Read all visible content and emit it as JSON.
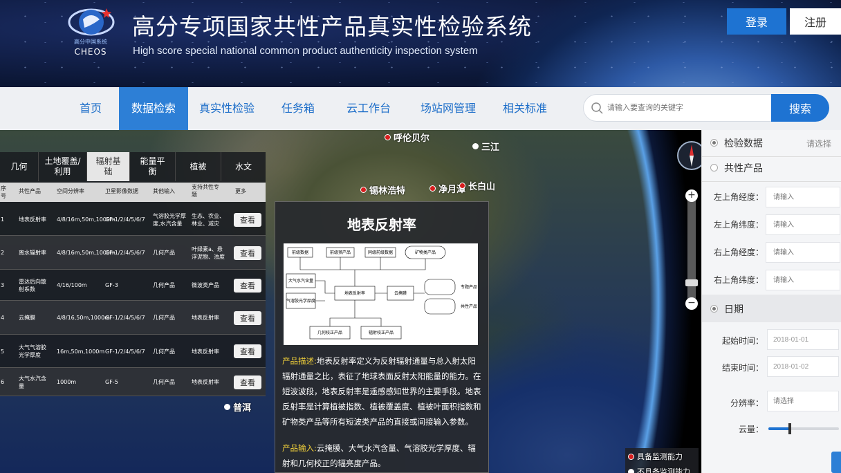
{
  "header": {
    "title_cn": "高分专项国家共性产品真实性检验系统",
    "title_en": "High score special national common product authenticity inspection system",
    "logo_text": "高分中国系统",
    "logo_brand": "CHEOS",
    "login": "登录",
    "register": "注册"
  },
  "nav": {
    "items": [
      "首页",
      "数据检索",
      "真实性检验",
      "任务箱",
      "云工作台",
      "场站网管理",
      "相关标准"
    ],
    "active": "数据检索",
    "search_placeholder": "请输入要查询的关键字",
    "search_button": "搜索"
  },
  "map": {
    "cities": [
      {
        "name": "呼伦贝尔",
        "dot": "red"
      },
      {
        "name": "三江",
        "dot": "white"
      },
      {
        "name": "锡林浩特",
        "dot": "red"
      },
      {
        "name": "净月潭",
        "dot": "red"
      },
      {
        "name": "长白山",
        "dot": "red"
      },
      {
        "name": "普洱",
        "dot": "white"
      }
    ],
    "legend": [
      "具备监测能力",
      "不具备监测能力"
    ]
  },
  "left_panel": {
    "tabs": [
      "几何",
      "土地覆盖/利用",
      "辐射基础",
      "能量平衡",
      "植被",
      "水文"
    ],
    "active_tab": "辐射基础",
    "headers": [
      "序号",
      "共性产品",
      "空间分辨率",
      "卫星影像数据",
      "其他输入",
      "支持共性专题",
      "更多"
    ],
    "rows": [
      {
        "no": "1",
        "product": "地表反射率",
        "resolution": "4/8/16m,50m,1000m",
        "satellite": "GF-1/2/4/5/6/7",
        "input": "气溶胶光学厚度,水汽含量",
        "topic": "生态、农业、林业、减灾",
        "action": "查看"
      },
      {
        "no": "2",
        "product": "离水辐射率",
        "resolution": "4/8/16m,50m,1000m",
        "satellite": "GF-1/2/4/5/6/7",
        "input": "几何产品",
        "topic": "叶绿素a、悬浮泥物、浊度",
        "action": "查看"
      },
      {
        "no": "3",
        "product": "雷达后向散射系数",
        "resolution": "4/16/100m",
        "satellite": "GF-3",
        "input": "几何产品",
        "topic": "微波类产品",
        "action": "查看"
      },
      {
        "no": "4",
        "product": "云掩膜",
        "resolution": "4/8/16,50m,1000m",
        "satellite": "GF-1/2/4/5/6/7",
        "input": "几何产品",
        "topic": "地表反射率",
        "action": "查看"
      },
      {
        "no": "5",
        "product": "大气气溶胶光学厚度",
        "resolution": "16m,50m,1000m",
        "satellite": "GF-1/2/4/5/6/7",
        "input": "几何产品",
        "topic": "地表反射率",
        "action": "查看"
      },
      {
        "no": "6",
        "product": "大气水汽含量",
        "resolution": "1000m",
        "satellite": "GF-5",
        "input": "几何产品",
        "topic": "地表反射率",
        "action": "查看"
      }
    ]
  },
  "popup": {
    "title": "地表反射率",
    "diagram": {
      "top": [
        "前级数据",
        "前级预产品",
        "同级前级数据",
        "矿物类产品"
      ],
      "left": [
        "大气水汽含量",
        "气溶胶光学厚度"
      ],
      "center": "地表反射率",
      "mid_right": "云掩膜",
      "right": [
        "专题产品",
        "共性产品"
      ],
      "bottom": [
        "几何校正产品",
        "辐射校正产品"
      ]
    },
    "desc_label": "产品描述:",
    "desc": "地表反射率定义为反射辐射通量与总入射太阳辐射通量之比，表征了地球表面反射太阳能量的能力。在短波波段，地表反射率是遥感感知世界的主要手段。地表反射率是计算植被指数、植被覆盖度、植被叶面积指数和矿物类产品等所有短波类产品的直接或间接输入参数。",
    "input_label": "产品输入:",
    "input": "云掩膜、大气水汽含量、气溶胶光学厚度、辐射和几何校正的辐亮度产品。"
  },
  "right_panel": {
    "radio1": "检验数据",
    "radio1_select": "请选择",
    "radio2": "共性产品",
    "fields": [
      {
        "label": "左上角经度：",
        "placeholder": "请输入"
      },
      {
        "label": "左上角纬度：",
        "placeholder": "请输入"
      },
      {
        "label": "右上角经度：",
        "placeholder": "请输入"
      },
      {
        "label": "右上角纬度：",
        "placeholder": "请输入"
      }
    ],
    "date_section": "日期",
    "start_label": "起始时间：",
    "start_value": "2018-01-01",
    "end_label": "结束时间：",
    "end_value": "2018-01-02",
    "resolution_label": "分辨率：",
    "resolution_placeholder": "请选择",
    "cloud_label": "云量：",
    "cloud_level": 0.3
  },
  "colors": {
    "accent": "#1e73d2",
    "nav_active": "#2d7fd6",
    "highlight": "#f4d23a"
  }
}
